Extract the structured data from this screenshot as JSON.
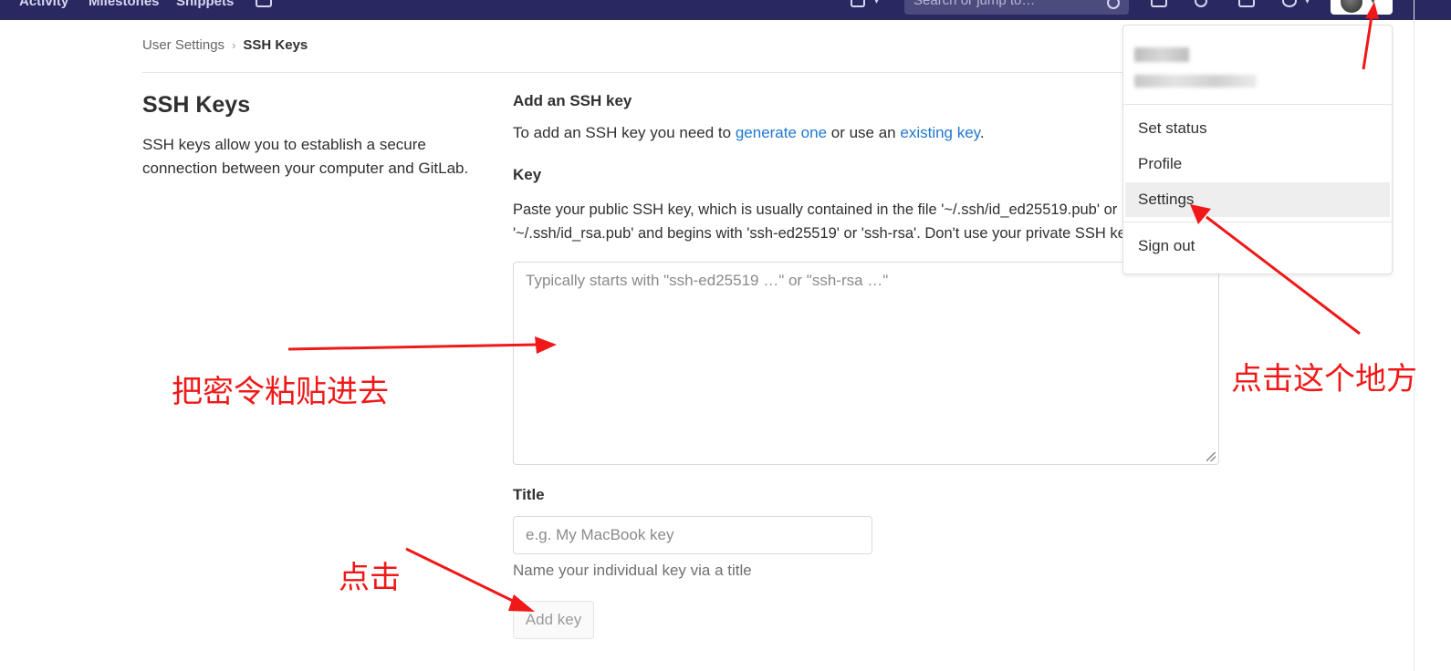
{
  "nav": {
    "links": [
      "Activity",
      "Milestones",
      "Snippets"
    ],
    "search_placeholder": "Search or jump to…"
  },
  "breadcrumb": {
    "parent": "User Settings",
    "separator": "›",
    "current": "SSH Keys"
  },
  "left": {
    "title": "SSH Keys",
    "description": "SSH keys allow you to establish a secure connection between your computer and GitLab."
  },
  "form": {
    "heading": "Add an SSH key",
    "intro_prefix": "To add an SSH key you need to ",
    "generate_link": "generate one",
    "intro_middle": " or use an ",
    "existing_link": "existing key",
    "intro_suffix": ".",
    "key_label": "Key",
    "key_help_line1": "Paste your public SSH key, which is usually contained in the file '~/.ssh/id_ed25519.pub' or",
    "key_help_line2": "'~/.ssh/id_rsa.pub' and begins with 'ssh-ed25519' or 'ssh-rsa'. Don't use your private SSH key.",
    "key_placeholder": "Typically starts with \"ssh-ed25519 …\" or \"ssh-rsa …\"",
    "title_label": "Title",
    "title_placeholder": "e.g. My MacBook key",
    "title_help": "Name your individual key via a title",
    "add_button": "Add key"
  },
  "dropdown": {
    "items": [
      "Set status",
      "Profile",
      "Settings",
      "Sign out"
    ],
    "active_item": "Settings"
  },
  "annotations": {
    "paste_hint": "把密令粘贴进去",
    "click_here": "点击这个地方",
    "click": "点击",
    "color": "#f01818"
  }
}
